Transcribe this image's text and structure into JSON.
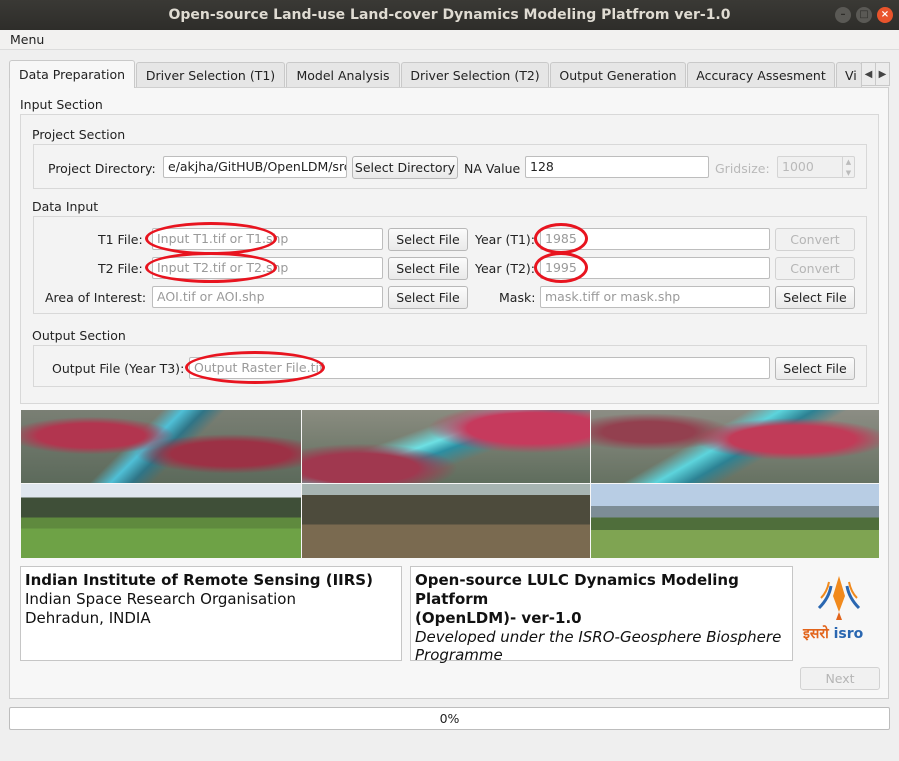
{
  "window": {
    "title": "Open-source Land-use Land-cover Dynamics Modeling Platfrom ver-1.0"
  },
  "menu": {
    "label": "Menu"
  },
  "tabs": [
    {
      "label": "Data Preparation"
    },
    {
      "label": "Driver Selection (T1)"
    },
    {
      "label": "Model Analysis"
    },
    {
      "label": "Driver Selection (T2)"
    },
    {
      "label": "Output Generation"
    },
    {
      "label": "Accuracy Assesment"
    },
    {
      "label": "Vi"
    }
  ],
  "input_section": {
    "title": "Input Section",
    "project": {
      "title": "Project Section",
      "dir_label": "Project Directory:",
      "dir_value": "e/akjha/GitHUB/OpenLDM/src",
      "select_dir_label": "Select Directory",
      "na_label": "NA Value",
      "na_value": "128",
      "gridsize_label": "Gridsize:",
      "gridsize_value": "1000"
    },
    "data_input": {
      "title": "Data Input",
      "t1_label": "T1 File:",
      "t1_placeholder": "Input T1.tif or T1.shp",
      "t2_label": "T2 File:",
      "t2_placeholder": "Input T2.tif or T2.shp",
      "aoi_label": "Area of Interest:",
      "aoi_placeholder": "AOI.tif or AOI.shp",
      "select_file_label": "Select File",
      "year_t1_label": "Year (T1):",
      "year_t1_placeholder": "1985",
      "year_t2_label": "Year (T2):",
      "year_t2_placeholder": "1995",
      "convert_label": "Convert",
      "mask_label": "Mask:",
      "mask_placeholder": "mask.tiff or mask.shp"
    },
    "output": {
      "title": "Output Section",
      "file_label": "Output File (Year T3):",
      "file_placeholder": "Output Raster File.tif",
      "select_file_label": "Select File"
    }
  },
  "info": {
    "org_title": "Indian Institute of Remote Sensing (IIRS)",
    "org_line2": "Indian Space Research Organisation",
    "org_line3": "Dehradun, INDIA",
    "platform_title_1": "Open-source LULC Dynamics Modeling Platform",
    "platform_title_2": "(OpenLDM)- ver-1.0",
    "platform_sub_1": "Developed under the ISRO-Geosphere Biosphere",
    "platform_sub_2": "Programme",
    "logo_hindi": "इसरो",
    "logo_latin": "isro"
  },
  "next_label": "Next",
  "progress": {
    "value": 0,
    "text": "0%"
  }
}
